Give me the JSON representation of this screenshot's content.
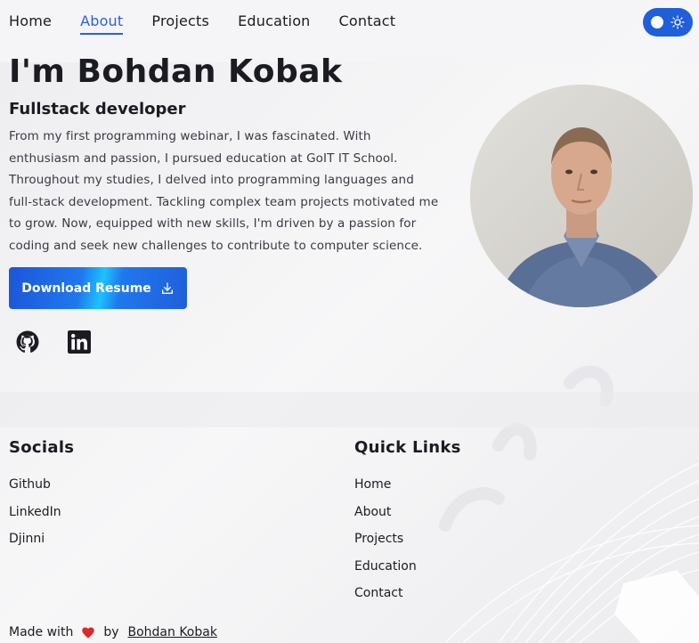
{
  "nav": {
    "items": [
      {
        "label": "Home",
        "active": false
      },
      {
        "label": "About",
        "active": true
      },
      {
        "label": "Projects",
        "active": false
      },
      {
        "label": "Education",
        "active": false
      },
      {
        "label": "Contact",
        "active": false
      }
    ],
    "theme_toggle_icon": "sun-icon"
  },
  "hero": {
    "title": "I'm Bohdan Kobak",
    "subtitle": "Fullstack developer",
    "description": "From my first programming webinar, I was fascinated. With enthusiasm and passion, I pursued education at GoIT IT School. Throughout my studies, I delved into programming languages and full-stack development. Tackling complex team projects motivated me to grow. Now, equipped with new skills, I'm driven by a passion for coding and seek new challenges to contribute to computer science.",
    "resume_button": "Download Resume",
    "social_icons": [
      "github-icon",
      "linkedin-icon"
    ]
  },
  "footer": {
    "socials": {
      "title": "Socials",
      "links": [
        "Github",
        "LinkedIn",
        "Djinni"
      ]
    },
    "quick_links": {
      "title": "Quick Links",
      "links": [
        "Home",
        "About",
        "Projects",
        "Education",
        "Contact"
      ]
    },
    "made_with": "Made with",
    "by": "by",
    "author": "Bohdan Kobak"
  },
  "colors": {
    "accent": "#1f5fd9",
    "heart": "#e0262b",
    "text": "#1b1b22",
    "background": "#f2f2f4"
  }
}
